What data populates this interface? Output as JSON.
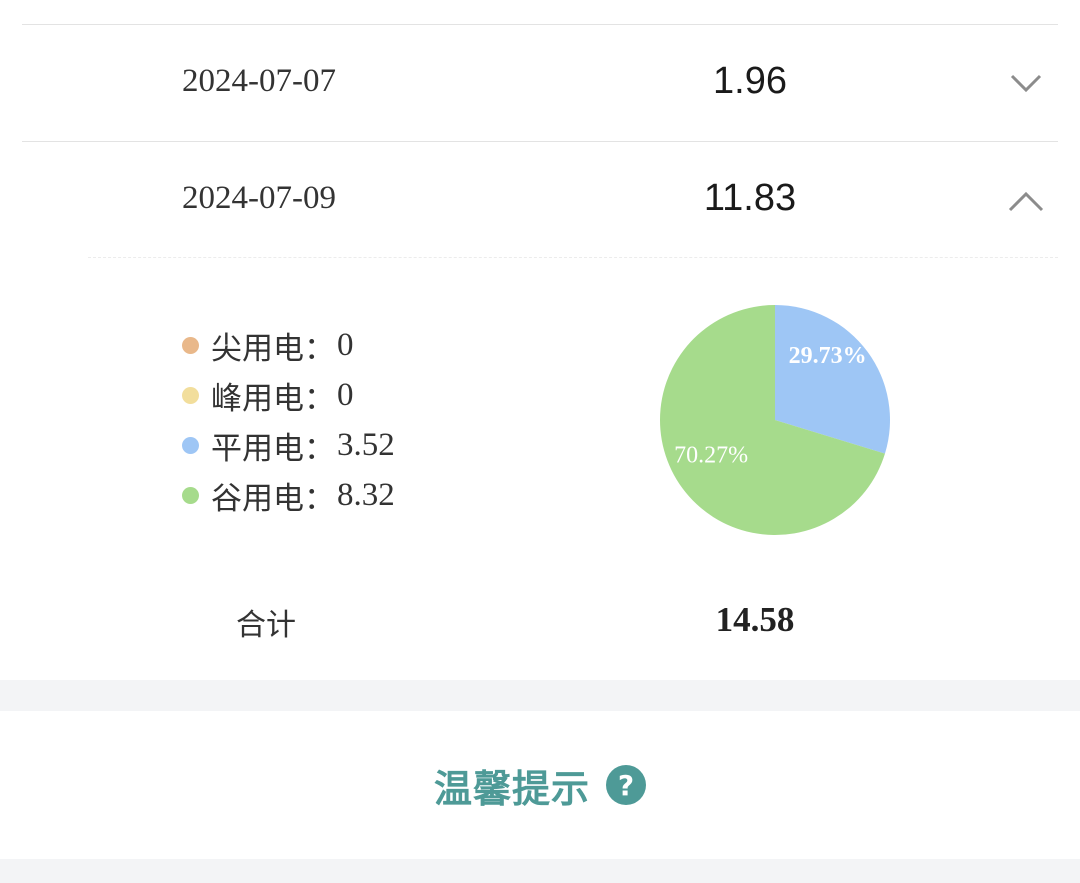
{
  "records": [
    {
      "date": "2024-07-07",
      "value": "1.96",
      "expanded": false
    },
    {
      "date": "2024-07-09",
      "value": "11.83",
      "expanded": true
    }
  ],
  "breakdown": {
    "items": [
      {
        "label": "尖用电：",
        "value": "0",
        "color": "#e9b88a"
      },
      {
        "label": "峰用电：",
        "value": "0",
        "color": "#f2de9c"
      },
      {
        "label": "平用电：",
        "value": "3.52",
        "color": "#9ec6f5"
      },
      {
        "label": "谷用电：",
        "value": "8.32",
        "color": "#a6db8c"
      }
    ],
    "total_label": "合计",
    "total_value": "14.58"
  },
  "chart_data": {
    "type": "pie",
    "slices": [
      {
        "value": 3.52,
        "percent_label": "29.73%",
        "color": "#9ec6f5"
      },
      {
        "value": 8.32,
        "percent_label": "70.27%",
        "color": "#a6db8c"
      }
    ]
  },
  "tips": {
    "title": "温馨提示",
    "help_glyph": "?",
    "color": "#4e9a97"
  }
}
